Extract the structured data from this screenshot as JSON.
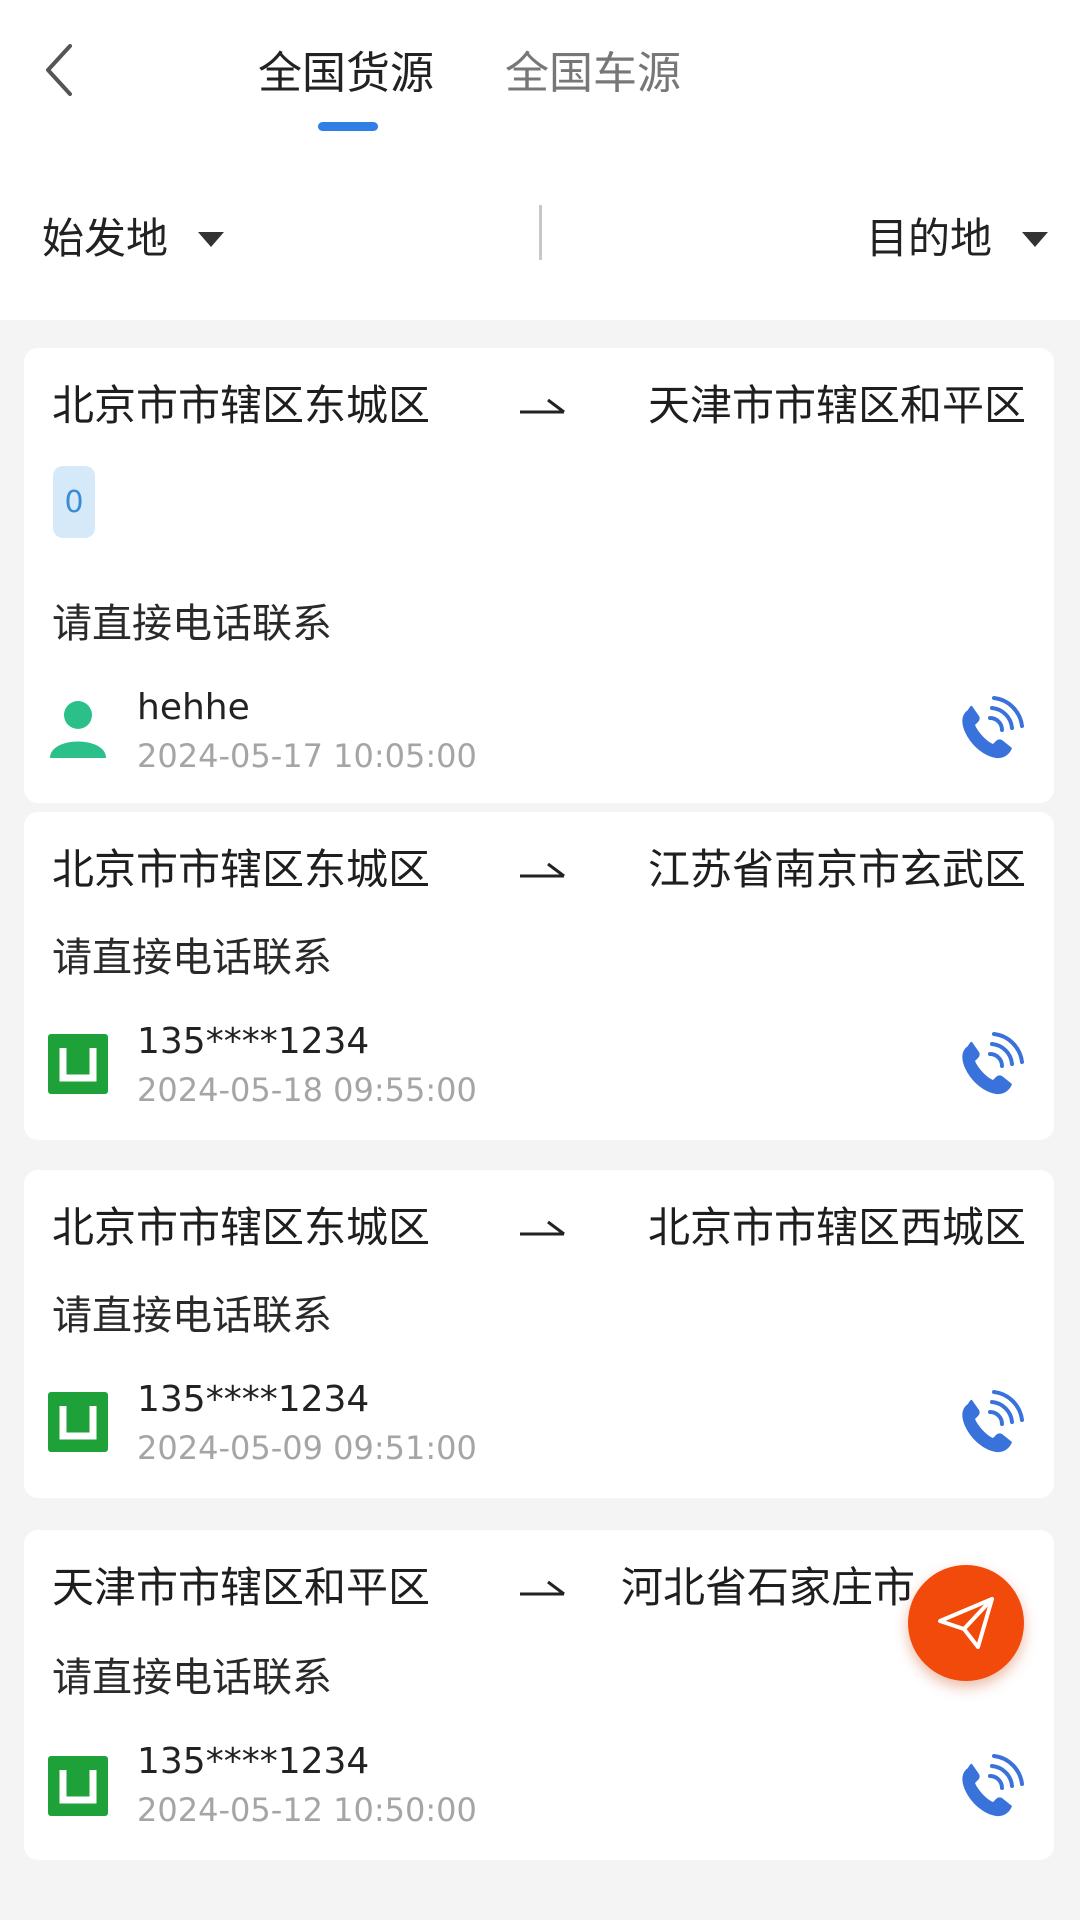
{
  "header": {
    "tabs": [
      {
        "label": "全国货源",
        "active": true
      },
      {
        "label": "全国车源",
        "active": false
      }
    ],
    "accent_color": "#2f7fe5"
  },
  "filters": {
    "origin_label": "始发地",
    "destination_label": "目的地"
  },
  "listings": [
    {
      "from": "北京市市辖区东城区",
      "to": "天津市市辖区和平区",
      "tag": "0",
      "note": "请直接电话联系",
      "user": "hehhe",
      "time": "2024-05-17 10:05:00",
      "avatar_icon": "person-icon"
    },
    {
      "from": "北京市市辖区东城区",
      "to": "江苏省南京市玄武区",
      "note": "请直接电话联系",
      "user": "135****1234",
      "time": "2024-05-18 09:55:00",
      "avatar_icon": "app-logo-icon"
    },
    {
      "from": "北京市市辖区东城区",
      "to": "北京市市辖区西城区",
      "note": "请直接电话联系",
      "user": "135****1234",
      "time": "2024-05-09 09:51:00",
      "avatar_icon": "app-logo-icon"
    },
    {
      "from": "天津市市辖区和平区",
      "to": "河北省石家庄市",
      "note": "请直接电话联系",
      "user": "135****1234",
      "time": "2024-05-12 10:50:00",
      "avatar_icon": "app-logo-icon"
    }
  ],
  "fab": {
    "icon": "send-icon",
    "color": "#f24a0a"
  }
}
